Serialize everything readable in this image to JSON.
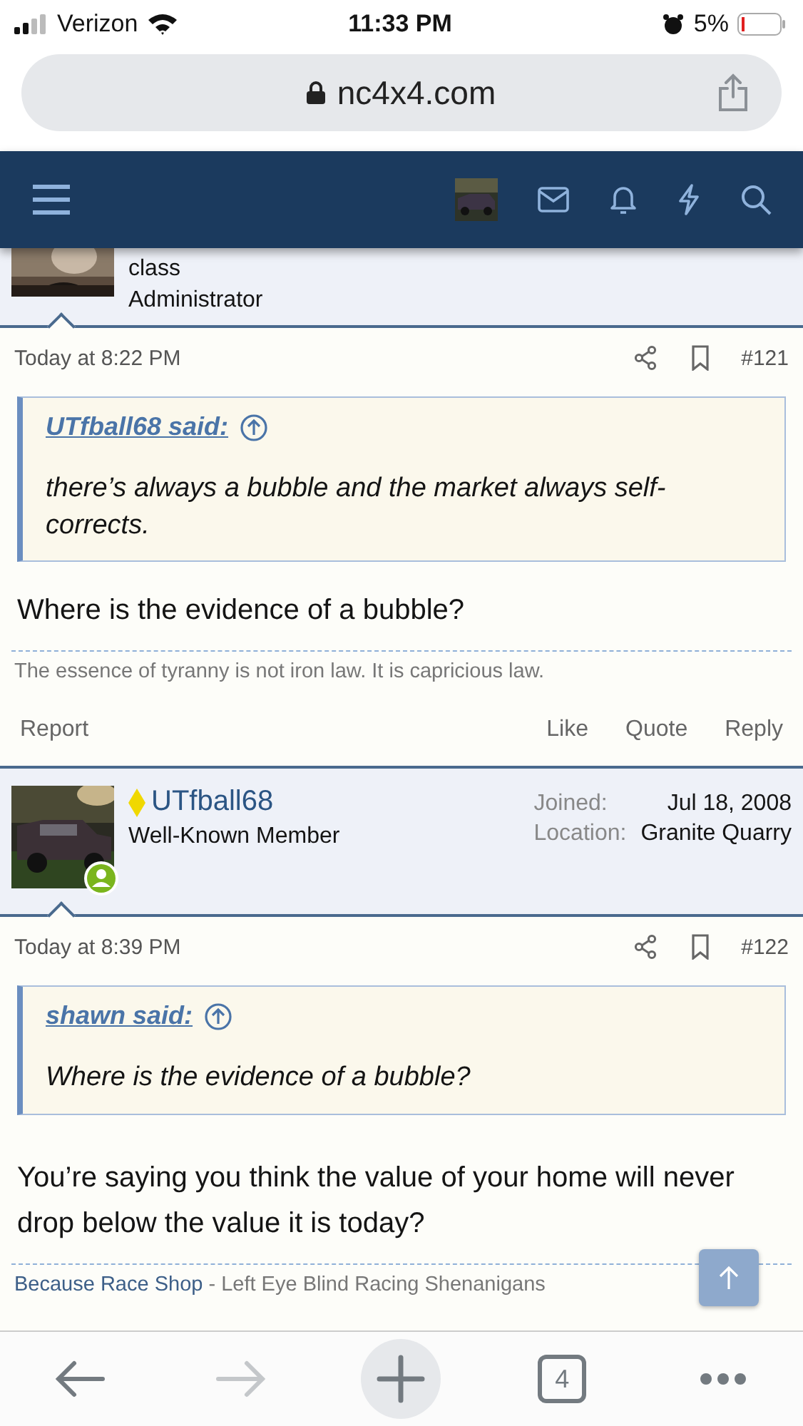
{
  "status_bar": {
    "carrier": "Verizon",
    "time": "11:33 PM",
    "battery": "5%"
  },
  "address_bar": {
    "url": "nc4x4.com"
  },
  "posts": [
    {
      "user": {
        "kind": "partial",
        "lines": [
          "class",
          "Administrator"
        ]
      },
      "date": "Today at 8:22 PM",
      "number": "#121",
      "quote": {
        "author": "UTfball68 said:",
        "text": "there’s always a bubble and the market always self-corrects."
      },
      "body": [
        "Where is the evidence of a bubble?"
      ],
      "signature": {
        "text": "The essence of tyranny is not iron law. It is capricious law."
      },
      "actions": {
        "left": "Report",
        "right": [
          "Like",
          "Quote",
          "Reply"
        ]
      }
    },
    {
      "user": {
        "kind": "full",
        "name": "UTfball68",
        "title": "Well-Known Member",
        "online": true,
        "stats": [
          {
            "label": "Joined:",
            "value": "Jul 18, 2008"
          },
          {
            "label": "Location:",
            "value": "Granite Quarry"
          }
        ]
      },
      "date": "Today at 8:39 PM",
      "number": "#122",
      "quote": {
        "author": "shawn said:",
        "text": "Where is the evidence of a bubble?"
      },
      "body": [
        "You’re saying you think the value of your home will never drop below the value it is today?"
      ],
      "signature": {
        "link": "Because Race Shop",
        "text": "- Left Eye Blind Racing Shenanigans"
      }
    }
  ],
  "toolbar": {
    "tabs": "4",
    "forward_disabled": true
  }
}
